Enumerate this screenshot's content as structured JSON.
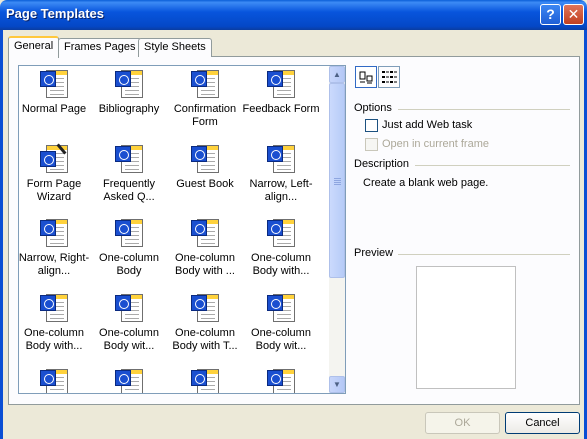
{
  "window": {
    "title": "Page Templates"
  },
  "titlebar_buttons": [
    {
      "name": "help",
      "glyph": "?"
    },
    {
      "name": "close",
      "glyph": "✕"
    }
  ],
  "tabs": [
    {
      "label": "General",
      "active": true
    },
    {
      "label": "Frames Pages",
      "active": false
    },
    {
      "label": "Style Sheets",
      "active": false
    }
  ],
  "templates": [
    {
      "label": "Normal Page",
      "icon": "page-globe-icon"
    },
    {
      "label": "Bibliography",
      "icon": "page-globe-icon"
    },
    {
      "label": "Confirmation Form",
      "icon": "page-globe-icon"
    },
    {
      "label": "Feedback Form",
      "icon": "page-globe-icon"
    },
    {
      "label": "Form Page Wizard",
      "icon": "page-wand-icon"
    },
    {
      "label": "Frequently Asked Q...",
      "icon": "page-globe-icon"
    },
    {
      "label": "Guest Book",
      "icon": "page-globe-icon"
    },
    {
      "label": "Narrow, Left-align...",
      "icon": "page-globe-icon"
    },
    {
      "label": "Narrow, Right-align...",
      "icon": "page-globe-icon"
    },
    {
      "label": "One-column Body",
      "icon": "page-globe-icon"
    },
    {
      "label": "One-column Body with ...",
      "icon": "page-globe-icon"
    },
    {
      "label": "One-column Body with...",
      "icon": "page-globe-icon"
    },
    {
      "label": "One-column Body with...",
      "icon": "page-globe-icon"
    },
    {
      "label": "One-column Body wit...",
      "icon": "page-globe-icon"
    },
    {
      "label": "One-column Body with T...",
      "icon": "page-globe-icon"
    },
    {
      "label": "One-column Body wit...",
      "icon": "page-globe-icon"
    },
    {
      "label": "",
      "icon": "page-globe-icon"
    },
    {
      "label": "",
      "icon": "page-globe-icon"
    },
    {
      "label": "",
      "icon": "page-globe-icon"
    },
    {
      "label": "",
      "icon": "page-globe-icon"
    }
  ],
  "options": {
    "heading": "Options",
    "just_add_web_task": {
      "label": "Just add Web task",
      "checked": false,
      "enabled": true
    },
    "open_in_current_frame": {
      "label": "Open in current frame",
      "checked": false,
      "enabled": false
    }
  },
  "description": {
    "heading": "Description",
    "text": "Create a blank web page."
  },
  "preview": {
    "heading": "Preview"
  },
  "buttons": {
    "ok": "OK",
    "cancel": "Cancel"
  },
  "colors": {
    "titlebar": "#0a58d8",
    "dialog_bg": "#ece9d8",
    "tab_accent": "#ffc83c"
  }
}
